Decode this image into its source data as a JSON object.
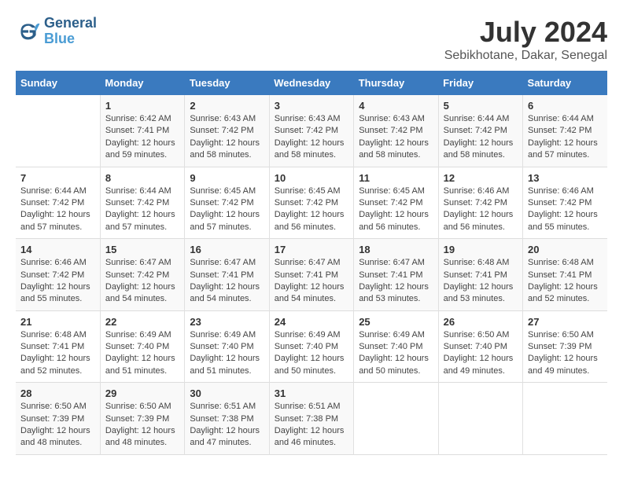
{
  "header": {
    "logo_line1": "General",
    "logo_line2": "Blue",
    "month_year": "July 2024",
    "location": "Sebikhotane, Dakar, Senegal"
  },
  "weekdays": [
    "Sunday",
    "Monday",
    "Tuesday",
    "Wednesday",
    "Thursday",
    "Friday",
    "Saturday"
  ],
  "weeks": [
    [
      {
        "day": "",
        "sunrise": "",
        "sunset": "",
        "daylight": ""
      },
      {
        "day": "1",
        "sunrise": "Sunrise: 6:42 AM",
        "sunset": "Sunset: 7:41 PM",
        "daylight": "Daylight: 12 hours and 59 minutes."
      },
      {
        "day": "2",
        "sunrise": "Sunrise: 6:43 AM",
        "sunset": "Sunset: 7:42 PM",
        "daylight": "Daylight: 12 hours and 58 minutes."
      },
      {
        "day": "3",
        "sunrise": "Sunrise: 6:43 AM",
        "sunset": "Sunset: 7:42 PM",
        "daylight": "Daylight: 12 hours and 58 minutes."
      },
      {
        "day": "4",
        "sunrise": "Sunrise: 6:43 AM",
        "sunset": "Sunset: 7:42 PM",
        "daylight": "Daylight: 12 hours and 58 minutes."
      },
      {
        "day": "5",
        "sunrise": "Sunrise: 6:44 AM",
        "sunset": "Sunset: 7:42 PM",
        "daylight": "Daylight: 12 hours and 58 minutes."
      },
      {
        "day": "6",
        "sunrise": "Sunrise: 6:44 AM",
        "sunset": "Sunset: 7:42 PM",
        "daylight": "Daylight: 12 hours and 57 minutes."
      }
    ],
    [
      {
        "day": "7",
        "sunrise": "Sunrise: 6:44 AM",
        "sunset": "Sunset: 7:42 PM",
        "daylight": "Daylight: 12 hours and 57 minutes."
      },
      {
        "day": "8",
        "sunrise": "Sunrise: 6:44 AM",
        "sunset": "Sunset: 7:42 PM",
        "daylight": "Daylight: 12 hours and 57 minutes."
      },
      {
        "day": "9",
        "sunrise": "Sunrise: 6:45 AM",
        "sunset": "Sunset: 7:42 PM",
        "daylight": "Daylight: 12 hours and 57 minutes."
      },
      {
        "day": "10",
        "sunrise": "Sunrise: 6:45 AM",
        "sunset": "Sunset: 7:42 PM",
        "daylight": "Daylight: 12 hours and 56 minutes."
      },
      {
        "day": "11",
        "sunrise": "Sunrise: 6:45 AM",
        "sunset": "Sunset: 7:42 PM",
        "daylight": "Daylight: 12 hours and 56 minutes."
      },
      {
        "day": "12",
        "sunrise": "Sunrise: 6:46 AM",
        "sunset": "Sunset: 7:42 PM",
        "daylight": "Daylight: 12 hours and 56 minutes."
      },
      {
        "day": "13",
        "sunrise": "Sunrise: 6:46 AM",
        "sunset": "Sunset: 7:42 PM",
        "daylight": "Daylight: 12 hours and 55 minutes."
      }
    ],
    [
      {
        "day": "14",
        "sunrise": "Sunrise: 6:46 AM",
        "sunset": "Sunset: 7:42 PM",
        "daylight": "Daylight: 12 hours and 55 minutes."
      },
      {
        "day": "15",
        "sunrise": "Sunrise: 6:47 AM",
        "sunset": "Sunset: 7:42 PM",
        "daylight": "Daylight: 12 hours and 54 minutes."
      },
      {
        "day": "16",
        "sunrise": "Sunrise: 6:47 AM",
        "sunset": "Sunset: 7:41 PM",
        "daylight": "Daylight: 12 hours and 54 minutes."
      },
      {
        "day": "17",
        "sunrise": "Sunrise: 6:47 AM",
        "sunset": "Sunset: 7:41 PM",
        "daylight": "Daylight: 12 hours and 54 minutes."
      },
      {
        "day": "18",
        "sunrise": "Sunrise: 6:47 AM",
        "sunset": "Sunset: 7:41 PM",
        "daylight": "Daylight: 12 hours and 53 minutes."
      },
      {
        "day": "19",
        "sunrise": "Sunrise: 6:48 AM",
        "sunset": "Sunset: 7:41 PM",
        "daylight": "Daylight: 12 hours and 53 minutes."
      },
      {
        "day": "20",
        "sunrise": "Sunrise: 6:48 AM",
        "sunset": "Sunset: 7:41 PM",
        "daylight": "Daylight: 12 hours and 52 minutes."
      }
    ],
    [
      {
        "day": "21",
        "sunrise": "Sunrise: 6:48 AM",
        "sunset": "Sunset: 7:41 PM",
        "daylight": "Daylight: 12 hours and 52 minutes."
      },
      {
        "day": "22",
        "sunrise": "Sunrise: 6:49 AM",
        "sunset": "Sunset: 7:40 PM",
        "daylight": "Daylight: 12 hours and 51 minutes."
      },
      {
        "day": "23",
        "sunrise": "Sunrise: 6:49 AM",
        "sunset": "Sunset: 7:40 PM",
        "daylight": "Daylight: 12 hours and 51 minutes."
      },
      {
        "day": "24",
        "sunrise": "Sunrise: 6:49 AM",
        "sunset": "Sunset: 7:40 PM",
        "daylight": "Daylight: 12 hours and 50 minutes."
      },
      {
        "day": "25",
        "sunrise": "Sunrise: 6:49 AM",
        "sunset": "Sunset: 7:40 PM",
        "daylight": "Daylight: 12 hours and 50 minutes."
      },
      {
        "day": "26",
        "sunrise": "Sunrise: 6:50 AM",
        "sunset": "Sunset: 7:40 PM",
        "daylight": "Daylight: 12 hours and 49 minutes."
      },
      {
        "day": "27",
        "sunrise": "Sunrise: 6:50 AM",
        "sunset": "Sunset: 7:39 PM",
        "daylight": "Daylight: 12 hours and 49 minutes."
      }
    ],
    [
      {
        "day": "28",
        "sunrise": "Sunrise: 6:50 AM",
        "sunset": "Sunset: 7:39 PM",
        "daylight": "Daylight: 12 hours and 48 minutes."
      },
      {
        "day": "29",
        "sunrise": "Sunrise: 6:50 AM",
        "sunset": "Sunset: 7:39 PM",
        "daylight": "Daylight: 12 hours and 48 minutes."
      },
      {
        "day": "30",
        "sunrise": "Sunrise: 6:51 AM",
        "sunset": "Sunset: 7:38 PM",
        "daylight": "Daylight: 12 hours and 47 minutes."
      },
      {
        "day": "31",
        "sunrise": "Sunrise: 6:51 AM",
        "sunset": "Sunset: 7:38 PM",
        "daylight": "Daylight: 12 hours and 46 minutes."
      },
      {
        "day": "",
        "sunrise": "",
        "sunset": "",
        "daylight": ""
      },
      {
        "day": "",
        "sunrise": "",
        "sunset": "",
        "daylight": ""
      },
      {
        "day": "",
        "sunrise": "",
        "sunset": "",
        "daylight": ""
      }
    ]
  ]
}
